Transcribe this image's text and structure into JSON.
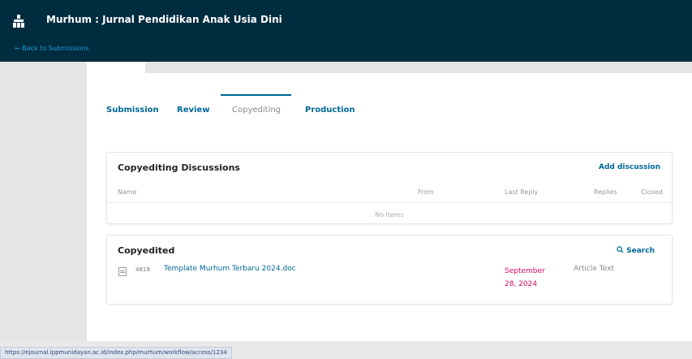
{
  "header": {
    "logo_icon": "ojs-logo-icon",
    "title": "Murhum : Jurnal Pendidikan Anak Usia Dini",
    "back_link": "← Back to Submissions"
  },
  "tabs": [
    {
      "label": "Submission",
      "active": false
    },
    {
      "label": "Review",
      "active": false
    },
    {
      "label": "Copyediting",
      "active": true
    },
    {
      "label": "Production",
      "active": false
    }
  ],
  "discussions": {
    "title": "Copyediting Discussions",
    "add_label": "Add discussion",
    "columns": [
      "Name",
      "From",
      "Last Reply",
      "Replies",
      "Closed"
    ],
    "empty_text": "No Items"
  },
  "copyedited": {
    "title": "Copyedited",
    "search_icon": "search-icon",
    "search_label": "Search",
    "files": [
      {
        "id": "4819",
        "name": "Template Murhum Terbaru 2024.doc",
        "date": "September 28, 2024",
        "type": "Article Text"
      }
    ]
  },
  "status_bar": {
    "url": "https://ejournal.lppmunidayan.ac.id/index.php/murhum/workflow/access/1234"
  },
  "colors": {
    "header_bg": "#002c40",
    "link": "#006798",
    "date": "#d00a6c"
  }
}
